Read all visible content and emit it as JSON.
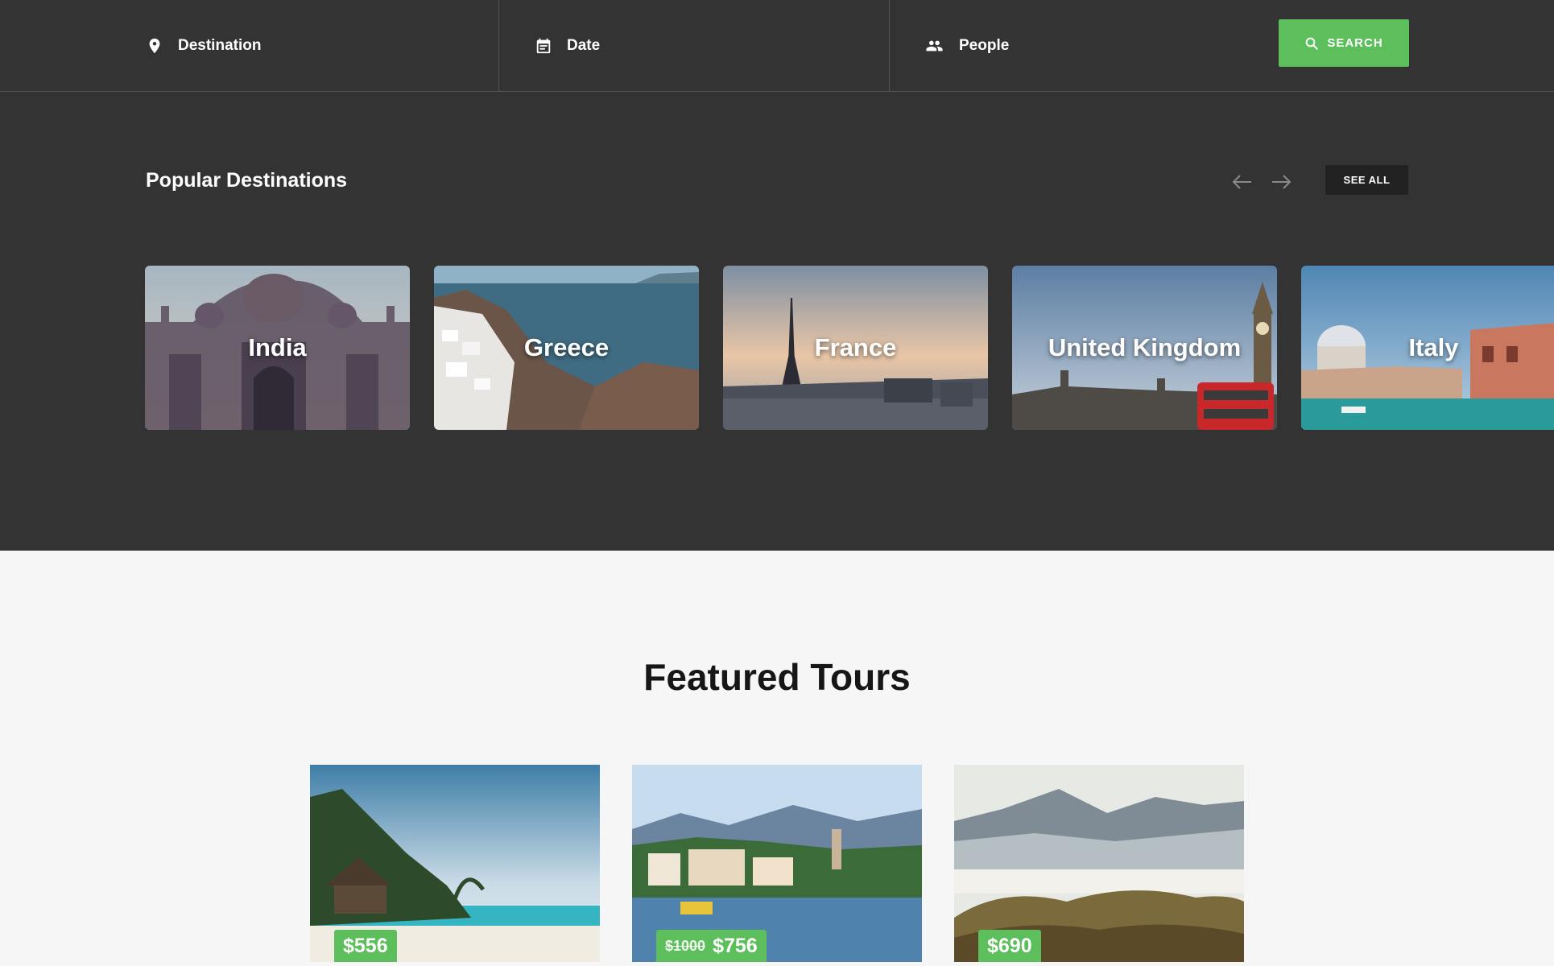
{
  "search_bar": {
    "destination_label": "Destination",
    "date_label": "Date",
    "people_label": "People",
    "search_button": "SEARCH"
  },
  "popular": {
    "title": "Popular Destinations",
    "see_all": "SEE ALL",
    "destinations": [
      {
        "name": "India"
      },
      {
        "name": "Greece"
      },
      {
        "name": "France"
      },
      {
        "name": "United Kingdom"
      },
      {
        "name": "Italy"
      }
    ]
  },
  "featured": {
    "title": "Featured Tours",
    "tours": [
      {
        "price": "$556",
        "old_price": ""
      },
      {
        "price": "$756",
        "old_price": "$1000"
      },
      {
        "price": "$690",
        "old_price": ""
      }
    ]
  },
  "colors": {
    "accent_green": "#5cbf5b",
    "dark_bg": "#333333",
    "light_bg": "#f6f6f6"
  },
  "icons": [
    "location-pin-icon",
    "calendar-icon",
    "people-icon",
    "search-icon",
    "arrow-left-icon",
    "arrow-right-icon"
  ]
}
